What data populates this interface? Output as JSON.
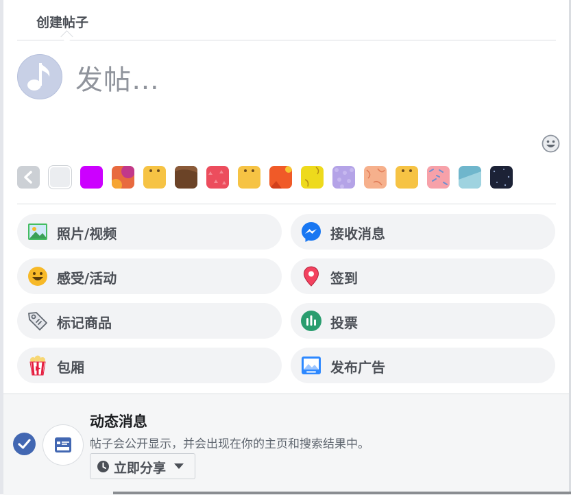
{
  "tab": {
    "title": "创建帖子"
  },
  "composer": {
    "placeholder": "发帖…"
  },
  "backgrounds": {
    "colors": [
      "#cc00ff",
      "#e86a3f",
      "#f6c344",
      "#6b4327",
      "#ec4d5d",
      "#f6c344",
      "#f05a28",
      "#eeda1c",
      "#b4a3e7",
      "#f6b08c",
      "#f6c344",
      "#f7a1a9",
      "#6fb6cc",
      "#1c2236"
    ]
  },
  "actions": [
    {
      "label": "照片/视频",
      "icon": "photo-icon"
    },
    {
      "label": "接收消息",
      "icon": "messenger-icon"
    },
    {
      "label": "感受/活动",
      "icon": "smiley-icon"
    },
    {
      "label": "签到",
      "icon": "location-pin-icon"
    },
    {
      "label": "标记商品",
      "icon": "tag-icon"
    },
    {
      "label": "投票",
      "icon": "poll-icon"
    },
    {
      "label": "包厢",
      "icon": "popcorn-icon"
    },
    {
      "label": "发布广告",
      "icon": "ad-icon"
    }
  ],
  "audience": {
    "title": "动态消息",
    "description": "帖子会公开显示，并会出现在你的主页和搜索结果中。",
    "share_label": "立即分享"
  }
}
